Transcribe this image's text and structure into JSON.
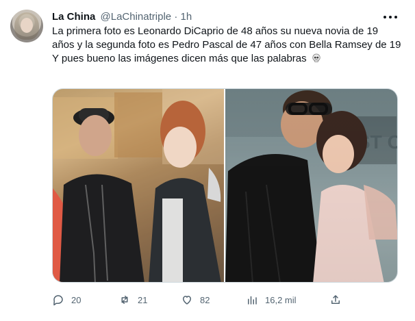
{
  "tweet": {
    "author_name": "La China",
    "handle": "@LaChinatriple",
    "separator": "·",
    "time": "1h",
    "text_line1": "La primera foto es Leonardo DiCaprio de 48 años su nueva novia de 19 años y la segunda foto es Pedro Pascal de 47 años con Bella Ramsey de 19",
    "text_line2": "Y pues bueno las imágenes dicen más que las palabras",
    "icons": {
      "more": "more-icon",
      "skull": "skull-emoji",
      "reply": "reply-icon",
      "retweet": "retweet-icon",
      "like": "like-icon",
      "views": "views-icon",
      "share": "share-icon"
    },
    "stats": {
      "replies": "20",
      "retweets": "21",
      "likes": "82",
      "views": "16,2 mil"
    }
  }
}
